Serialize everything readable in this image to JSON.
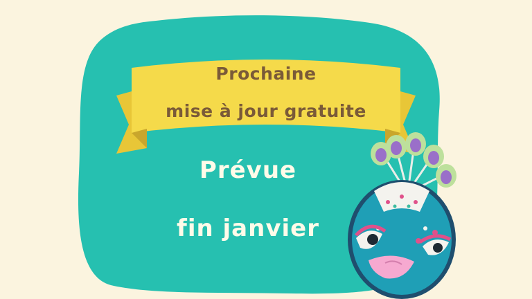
{
  "banner": {
    "line1": "Prochaine",
    "line2": "mise à jour gratuite"
  },
  "message": {
    "line1": "Prévue",
    "line2": "fin janvier"
  },
  "colors": {
    "background": "#fbf4df",
    "panel": "#26c0b0",
    "ribbon": "#f5da4a",
    "ribbon_text": "#7a5a38",
    "main_text": "#fffbe9"
  },
  "icons": [
    "peacock-mask-icon"
  ]
}
